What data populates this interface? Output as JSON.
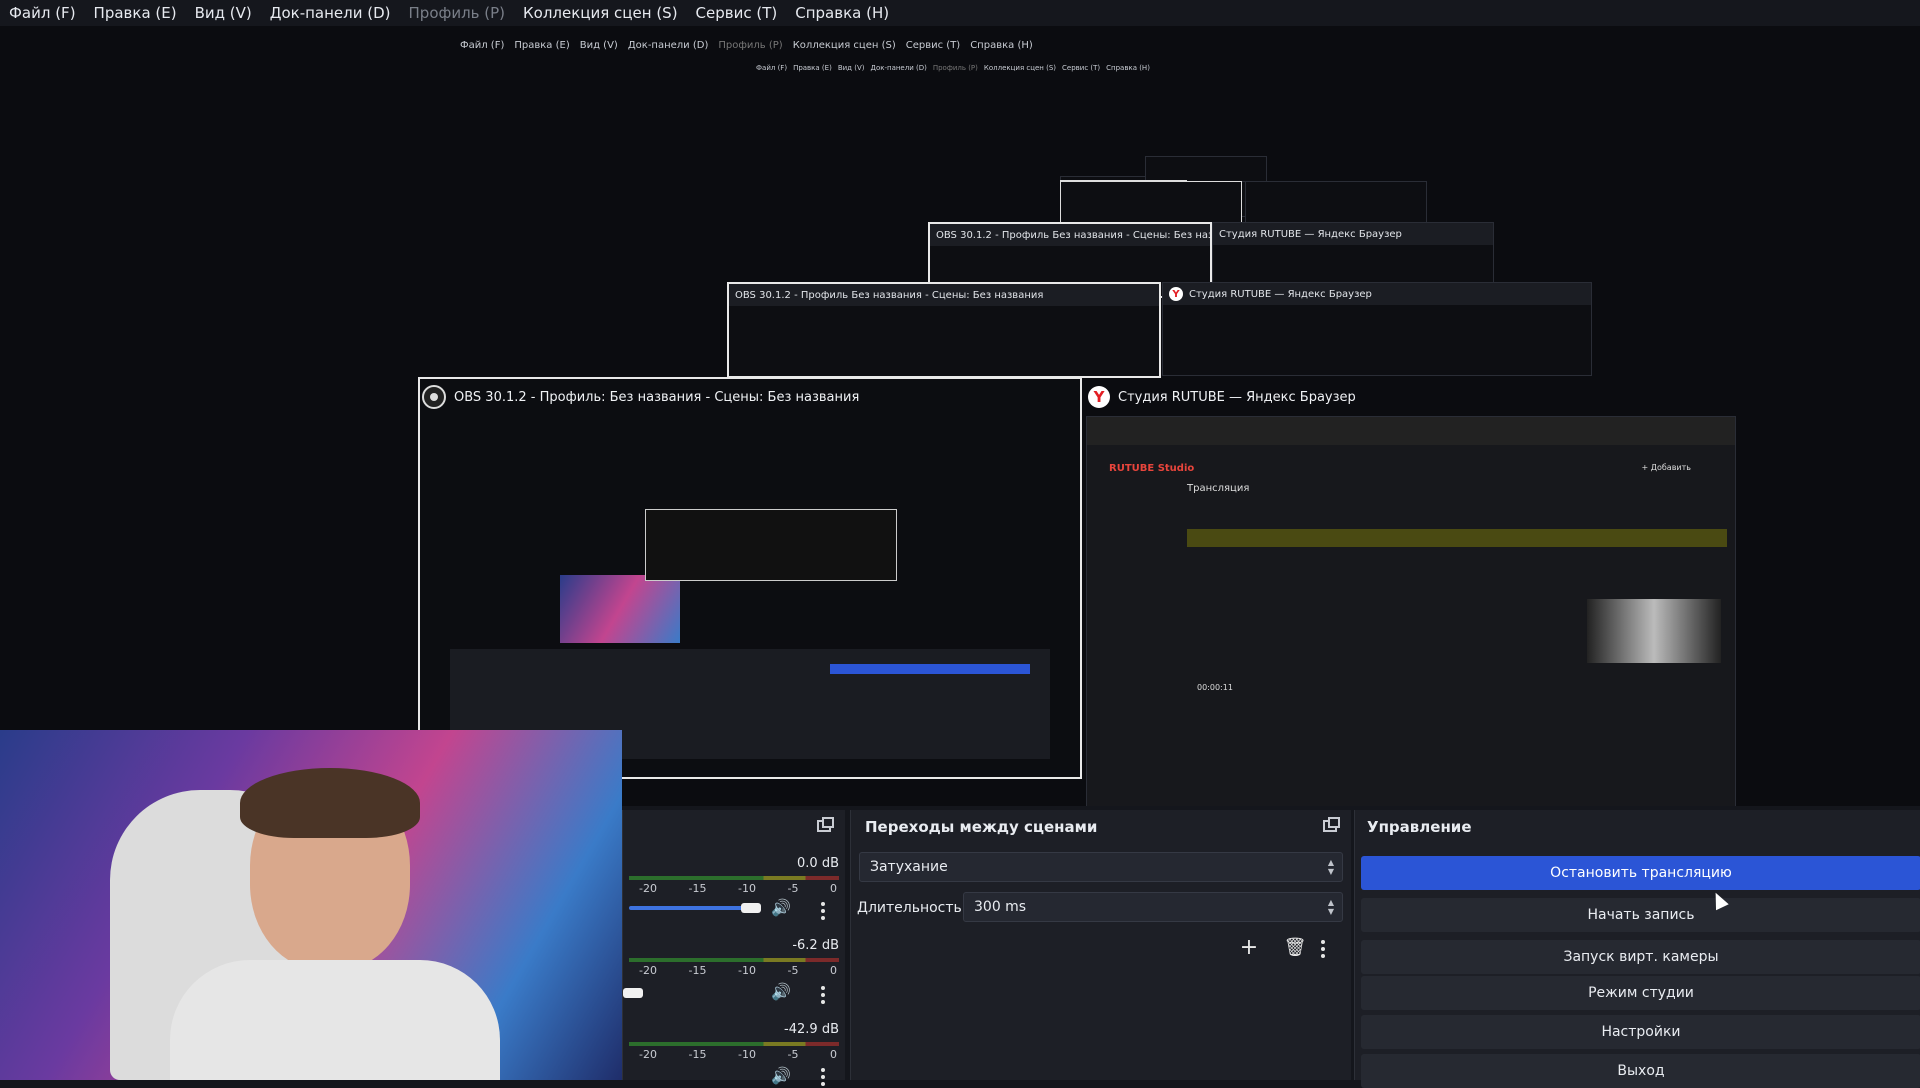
{
  "menu": [
    {
      "label": "Файл (F)",
      "disabled": false
    },
    {
      "label": "Правка (E)",
      "disabled": false
    },
    {
      "label": "Вид (V)",
      "disabled": false
    },
    {
      "label": "Док-панели (D)",
      "disabled": false
    },
    {
      "label": "Профиль (P)",
      "disabled": true
    },
    {
      "label": "Коллекция сцен (S)",
      "disabled": false
    },
    {
      "label": "Сервис (T)",
      "disabled": false
    },
    {
      "label": "Справка (H)",
      "disabled": false
    }
  ],
  "preview": {
    "obs_window_title": "OBS 30.1.2 - Профиль: Без названия - Сцены: Без названия",
    "browser_window_title": "Студия RUTUBE — Яндекс Браузер",
    "nested_obs_title": "OBS 30.1.2 - Профиль Без названия - Сцены: Без названия",
    "nested_browser_title": "Студия RUTUBE — Яндекс Браузер",
    "rutube": {
      "logo": "RUTUBE Studio",
      "page_title": "Трансляция",
      "add_label": "+ Добавить",
      "timer": "00:00:11"
    }
  },
  "mixer": {
    "channels": [
      {
        "db": "0.0 dB",
        "volume": 0.9
      },
      {
        "db": "-6.2 dB",
        "volume": 0.1
      },
      {
        "db": "-42.9 dB",
        "volume": 0.5
      }
    ],
    "scale": [
      "-20",
      "-15",
      "-10",
      "-5",
      "0"
    ]
  },
  "transitions": {
    "title": "Переходы между сценами",
    "transition": "Затухание",
    "duration_label": "Длительность",
    "duration_value": "300 ms"
  },
  "controls": {
    "title": "Управление",
    "buttons": [
      {
        "label": "Остановить трансляцию",
        "active": true
      },
      {
        "label": "Начать запись",
        "active": false
      },
      {
        "label": "Запуск вирт. камеры",
        "active": false
      },
      {
        "label": "Режим студии",
        "active": false
      },
      {
        "label": "Настройки",
        "active": false
      },
      {
        "label": "Выход",
        "active": false
      }
    ]
  },
  "colors": {
    "accent": "#2b55d6",
    "background": "#1d1f26",
    "meter_green": "#2c6e2c",
    "meter_red": "#7c2a2a"
  }
}
